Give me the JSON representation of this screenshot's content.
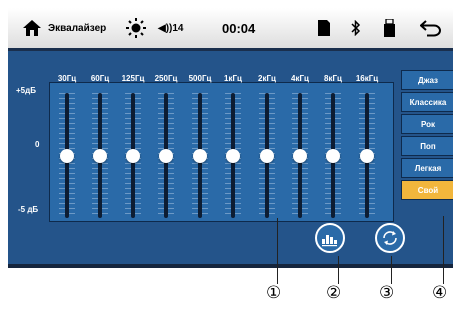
{
  "statusbar": {
    "title": "Эквалайзер",
    "volume": "◀))14",
    "time": "00:04"
  },
  "db_labels": {
    "top": "+5дБ",
    "mid": "0",
    "bottom": "-5 дБ"
  },
  "bands": [
    {
      "label": "30Гц",
      "level": 0
    },
    {
      "label": "60Гц",
      "level": 0
    },
    {
      "label": "125Гц",
      "level": 0
    },
    {
      "label": "250Гц",
      "level": 0
    },
    {
      "label": "500Гц",
      "level": 0
    },
    {
      "label": "1кГц",
      "level": 0
    },
    {
      "label": "2кГц",
      "level": 0
    },
    {
      "label": "4кГц",
      "level": 0
    },
    {
      "label": "8кГц",
      "level": 0
    },
    {
      "label": "16кГц",
      "level": 0
    }
  ],
  "presets": [
    {
      "label": "Джаз",
      "active": false
    },
    {
      "label": "Классика",
      "active": false
    },
    {
      "label": "Рок",
      "active": false
    },
    {
      "label": "Поп",
      "active": false
    },
    {
      "label": "Легкая",
      "active": false
    },
    {
      "label": "Свой",
      "active": true
    }
  ],
  "callouts": [
    "①",
    "②",
    "③",
    "④"
  ],
  "colors": {
    "background": "#24548a",
    "panel": "#2a6aa8",
    "active_preset": "#f2b63c"
  },
  "icons": [
    "home-icon",
    "brightness-icon",
    "volume-icon",
    "sd-card-icon",
    "bluetooth-icon",
    "usb-icon",
    "back-icon",
    "equalizer-icon",
    "refresh-icon"
  ]
}
